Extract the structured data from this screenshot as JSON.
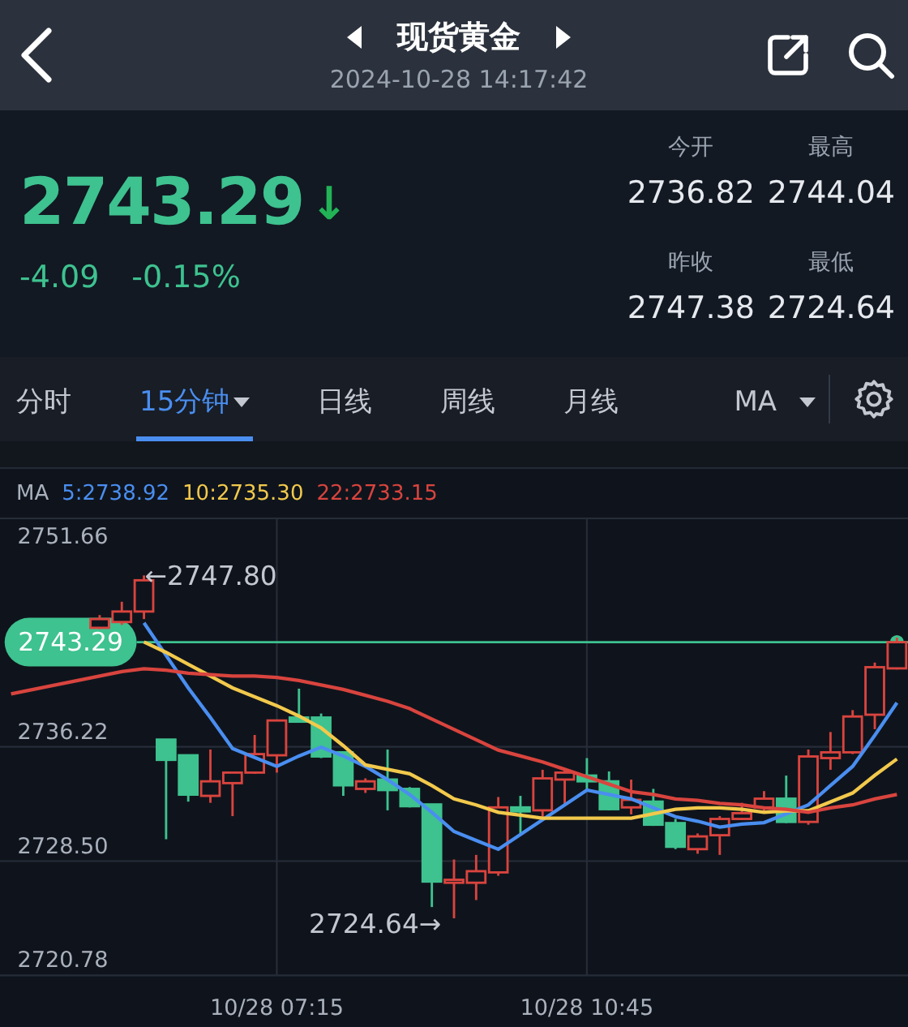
{
  "header": {
    "title": "现货黄金",
    "datetime": "2024-10-28 14:17:42"
  },
  "quote": {
    "price": "2743.29",
    "arrow": "↓",
    "change": "-4.09",
    "change_percent": "-0.15%",
    "stats": [
      {
        "label": "今开",
        "value": "2736.82"
      },
      {
        "label": "最高",
        "value": "2744.04"
      },
      {
        "label": "昨收",
        "value": "2747.38"
      },
      {
        "label": "最低",
        "value": "2724.64"
      }
    ]
  },
  "tabs": [
    {
      "label": "分时",
      "selected": false,
      "dropdown": false
    },
    {
      "label": "15分钟",
      "selected": true,
      "dropdown": true
    },
    {
      "label": "日线",
      "selected": false,
      "dropdown": false
    },
    {
      "label": "周线",
      "selected": false,
      "dropdown": false
    },
    {
      "label": "月线",
      "selected": false,
      "dropdown": false
    }
  ],
  "indicator": {
    "label": "MA",
    "dropdown": true
  },
  "chart": {
    "legend_title": "MA",
    "high_label": "←2747.80",
    "low_label": "2724.64→",
    "chart_data": {
      "type": "candlestick",
      "ylim": [
        2720.78,
        2751.66
      ],
      "grid": true,
      "ref_lines": [
        {
          "axis": "y",
          "value": 2743.29,
          "label": "2743.29",
          "color": "#3ec28f"
        }
      ],
      "yticks": [
        {
          "value": 2751.66,
          "label": "2751.66"
        },
        {
          "value": 2736.22,
          "label": "2736.22"
        },
        {
          "value": 2728.5,
          "label": "2728.50"
        },
        {
          "value": 2720.78,
          "label": "2720.78"
        }
      ],
      "categories": [
        null,
        null,
        null,
        null,
        null,
        null,
        null,
        null,
        null,
        null,
        null,
        null,
        "10/28 07:15",
        null,
        null,
        null,
        null,
        null,
        null,
        null,
        null,
        null,
        null,
        null,
        null,
        null,
        "10/28 10:45",
        null,
        null,
        null,
        null,
        null,
        null,
        null,
        null,
        null,
        null,
        null,
        null,
        null,
        null
      ],
      "ohlc": [
        null,
        null,
        null,
        null,
        [
          2744.26,
          2745.12,
          2744.18,
          2744.85
        ],
        [
          2744.65,
          2746.02,
          2744.46,
          2745.36
        ],
        [
          2745.36,
          2747.8,
          2744.85,
          2747.47
        ],
        [
          2736.71,
          2736.71,
          2729.98,
          2735.34
        ],
        [
          2735.65,
          2735.65,
          2732.52,
          2732.99
        ],
        [
          2732.91,
          2736.04,
          2732.44,
          2733.89
        ],
        [
          2733.77,
          2734.48,
          2731.54,
          2734.48
        ],
        [
          2734.48,
          2737.02,
          2734.4,
          2735.73
        ],
        [
          2735.65,
          2738.0,
          2734.48,
          2738.0
        ],
        [
          2738.2,
          2740.15,
          2737.92,
          2737.92
        ],
        [
          2738.2,
          2738.47,
          2735.46,
          2735.57
        ],
        [
          2735.85,
          2735.85,
          2732.91,
          2733.62
        ],
        [
          2733.38,
          2734.09,
          2733.11,
          2733.89
        ],
        [
          2734.01,
          2736.04,
          2731.93,
          2733.3
        ],
        [
          2733.38,
          2733.5,
          2732.13,
          2732.21
        ],
        [
          2732.33,
          2732.33,
          2725.4,
          2727.12
        ],
        [
          2727.04,
          2728.61,
          2724.64,
          2727.24
        ],
        [
          2727.04,
          2728.92,
          2725.87,
          2727.82
        ],
        [
          2727.74,
          2732.83,
          2727.51,
          2732.13
        ],
        [
          2732.13,
          2732.91,
          2730.37,
          2731.86
        ],
        [
          2731.93,
          2734.67,
          2731.35,
          2734.09
        ],
        [
          2734.01,
          2734.67,
          2732.33,
          2734.48
        ],
        [
          2734.28,
          2735.46,
          2733.3,
          2733.89
        ],
        [
          2733.89,
          2734.56,
          2731.93,
          2732.01
        ],
        [
          2732.13,
          2734.01,
          2731.66,
          2732.64
        ],
        [
          2732.52,
          2733.38,
          2730.88,
          2730.96
        ],
        [
          2731.07,
          2731.35,
          2729.31,
          2729.47
        ],
        [
          2729.31,
          2730.37,
          2729.0,
          2730.17
        ],
        [
          2730.25,
          2731.54,
          2728.92,
          2731.35
        ],
        [
          2731.35,
          2732.44,
          2731.27,
          2731.74
        ],
        [
          2732.13,
          2733.23,
          2731.74,
          2732.72
        ],
        [
          2732.72,
          2734.28,
          2731.07,
          2731.15
        ],
        [
          2731.15,
          2736.04,
          2730.96,
          2735.57
        ],
        [
          2735.46,
          2737.22,
          2734.67,
          2735.85
        ],
        [
          2735.85,
          2738.7,
          2735.73,
          2738.27
        ],
        [
          2738.39,
          2741.91,
          2737.41,
          2741.6
        ],
        [
          2741.52,
          2743.6,
          2741.45,
          2743.29
        ]
      ],
      "series": [
        {
          "name": "5:2738.92",
          "type": "line",
          "color": "#4a8ef0",
          "values": [
            null,
            null,
            null,
            null,
            null,
            null,
            2744.6,
            2742.4,
            2740.2,
            2738.2,
            2736.1,
            2735.5,
            2734.9,
            2735.6,
            2736.2,
            2735.6,
            2734.9,
            2734.0,
            2733.0,
            2731.8,
            2730.5,
            2729.9,
            2729.3,
            2730.3,
            2731.3,
            2732.3,
            2733.3,
            2733.0,
            2732.7,
            2732.1,
            2731.5,
            2731.2,
            2730.8,
            2731.0,
            2731.1,
            2731.7,
            2732.3,
            2733.6,
            2734.9,
            2737.0,
            2739.2
          ]
        },
        {
          "name": "10:2735.30",
          "type": "line",
          "color": "#f2c94c",
          "values": [
            null,
            null,
            null,
            null,
            null,
            null,
            2743.3,
            2742.6,
            2741.8,
            2741.0,
            2740.2,
            2739.6,
            2739.0,
            2738.3,
            2737.5,
            2736.3,
            2735.0,
            2734.7,
            2734.4,
            2733.6,
            2732.7,
            2732.3,
            2731.8,
            2731.6,
            2731.4,
            2731.4,
            2731.4,
            2731.4,
            2731.4,
            2731.7,
            2732.0,
            2732.1,
            2732.1,
            2732.0,
            2731.8,
            2731.9,
            2731.9,
            2732.5,
            2733.1,
            2734.3,
            2735.4
          ]
        },
        {
          "name": "22:2733.15",
          "type": "line",
          "color": "#d9443e",
          "values": [
            2739.8,
            2740.1,
            2740.4,
            2740.7,
            2741.0,
            2741.3,
            2741.5,
            2741.4,
            2741.2,
            2741.1,
            2741.0,
            2741.0,
            2740.9,
            2740.7,
            2740.4,
            2740.1,
            2739.7,
            2739.3,
            2738.8,
            2738.1,
            2737.4,
            2736.7,
            2736.0,
            2735.6,
            2735.2,
            2734.7,
            2734.2,
            2733.7,
            2733.2,
            2733.0,
            2732.7,
            2732.6,
            2732.4,
            2732.3,
            2732.1,
            2732.0,
            2731.8,
            2732.1,
            2732.3,
            2732.7,
            2733.0
          ]
        }
      ]
    }
  }
}
